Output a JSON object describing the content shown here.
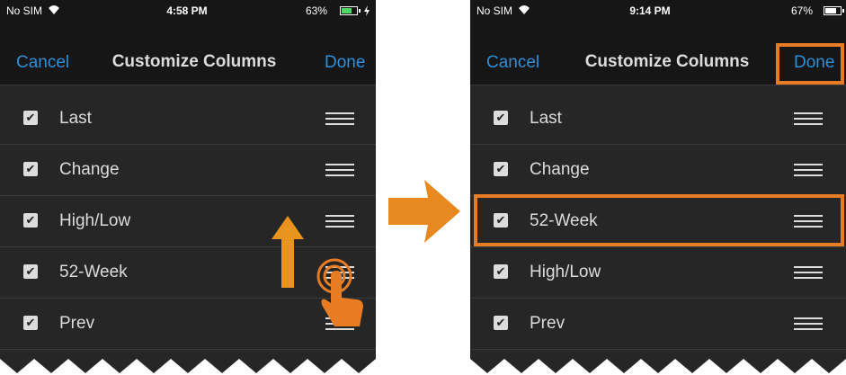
{
  "colors": {
    "accent": "#2f8fd6",
    "highlight": "#e87c22",
    "background": "#262626",
    "text": "#dcdcdc"
  },
  "left": {
    "status": {
      "carrier": "No SIM",
      "time": "4:58 PM",
      "battery": "63%"
    },
    "nav": {
      "cancel": "Cancel",
      "title": "Customize Columns",
      "done": "Done"
    },
    "rows": [
      {
        "label": "Last"
      },
      {
        "label": "Change"
      },
      {
        "label": "High/Low"
      },
      {
        "label": "52-Week"
      },
      {
        "label": "Prev"
      }
    ]
  },
  "right": {
    "status": {
      "carrier": "No SIM",
      "time": "9:14 PM",
      "battery": "67%"
    },
    "nav": {
      "cancel": "Cancel",
      "title": "Customize Columns",
      "done": "Done"
    },
    "rows": [
      {
        "label": "Last"
      },
      {
        "label": "Change"
      },
      {
        "label": "52-Week"
      },
      {
        "label": "High/Low"
      },
      {
        "label": "Prev"
      }
    ]
  },
  "icons": {
    "checkbox": "checkmark-icon",
    "grip": "drag-handle-icon",
    "step_arrow": "right-arrow-icon",
    "drag_arrow": "up-arrow-icon",
    "touch": "finger-tap-icon"
  }
}
